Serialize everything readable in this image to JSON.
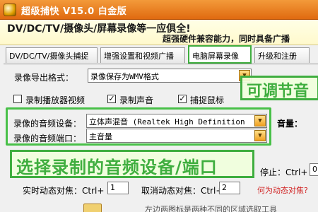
{
  "window": {
    "title": "超级捕快 V15.0 白金版"
  },
  "banner": {
    "line1": "DV/DC/TV/摄像头/屏幕录像等一应俱全!",
    "line2": "超强硬件兼容能力，同时具备广播"
  },
  "tabs": [
    {
      "label": "DV/DC/TV/摄像头捕捉",
      "active": false
    },
    {
      "label": "增强设置和视频广播",
      "active": false
    },
    {
      "label": "电脑屏幕录像",
      "active": true
    },
    {
      "label": "升级和注册",
      "active": false
    }
  ],
  "export_format": {
    "label": "录像导出格式：",
    "value": "录像保存为WMV格式"
  },
  "checkboxes": [
    {
      "label": "录制播放器视频",
      "checked": false
    },
    {
      "label": "录制声音",
      "checked": true
    },
    {
      "label": "捕捉鼠标",
      "checked": true
    }
  ],
  "audio": {
    "device_label": "录像的音频设备：",
    "device_value": "立体声混音 (Realtek High Definition",
    "port_label": "录像的音频端口：",
    "port_value": "主音量",
    "volume_label": "音量："
  },
  "hotkeys": {
    "stop_label": "停止：Ctrl+",
    "stop_value": "0",
    "realtime_label": "实时动态对焦：Ctrl+",
    "realtime_value": "1",
    "cancel_label": "取消动态对焦：Ctrl+",
    "cancel_value": "2",
    "help_link": "何为动态对焦?"
  },
  "overlays": {
    "adjustable": "可调节音",
    "select_audio": "选择录制的音频设备/端口"
  },
  "footer_text": "左边两图标是两种不同的区域选取工具"
}
